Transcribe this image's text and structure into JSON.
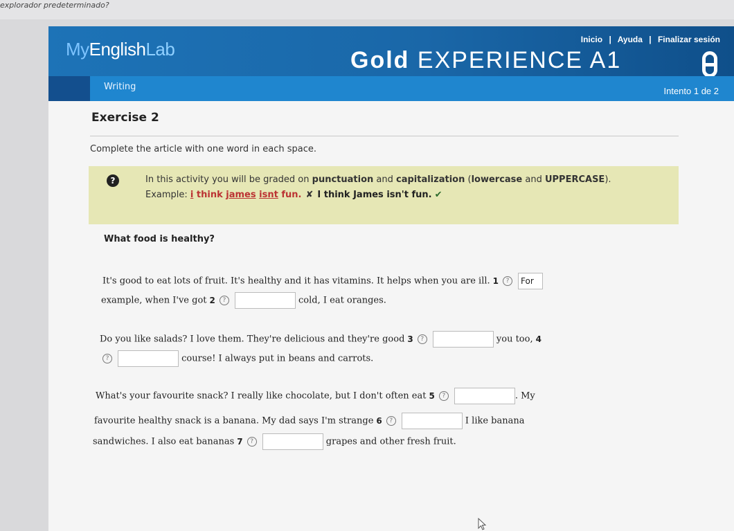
{
  "browser": {
    "title": "explorador predeterminado?"
  },
  "header": {
    "logo": {
      "my": "My",
      "english": "English",
      "lab": "Lab"
    },
    "links": [
      "Inicio",
      "Ayuda",
      "Finalizar sesión"
    ],
    "course_title": {
      "gold": "Gold",
      "rest": "EXPERIENCE A1"
    },
    "section": "Writing",
    "attempt": "Intento 1 de 2"
  },
  "exercise": {
    "title": "Exercise 2",
    "instruction": "Complete the article with one word in each space.",
    "note": {
      "prefix": "In this activity you will be graded on ",
      "punctuation": "punctuation",
      "and": " and ",
      "capitalization": "capitalization",
      "open": " (",
      "lowercase": "lowercase",
      "and2": " and ",
      "uppercase": "UPPERCASE",
      "close": ").",
      "example_label": "Example: ",
      "wrong_i": "i",
      "wrong_think": "think",
      "wrong_james": "james",
      "wrong_isnt": "isnt",
      "wrong_fun": "fun.",
      "cross": "✘",
      "right": "I think James isn't fun.",
      "check": "✔"
    }
  },
  "article": {
    "title": "What food is healthy?",
    "p1a": "It's good to eat lots of fruit. It's healthy and it has vitamins. It helps when you are ill.",
    "n1": "1",
    "a1": "For",
    "p1b": "example, when I've got",
    "n2": "2",
    "p1c": "cold, I eat oranges.",
    "p2a": "Do you like salads? I love them. They're delicious and they're good",
    "n3": "3",
    "p2b": "you too,",
    "n4": "4",
    "p2c": "course! I always put in beans and carrots.",
    "p3a": "What's your favourite snack? I really like chocolate, but I don't often eat",
    "n5": "5",
    "p3b": ". My",
    "p3c": "favourite healthy snack is a banana. My dad says I'm strange",
    "n6": "6",
    "p3d": "I like banana",
    "p3e": "sandwiches. I also eat bananas",
    "n7": "7",
    "p3f": "grapes and other fresh fruit.",
    "hint_symbol": "?"
  }
}
